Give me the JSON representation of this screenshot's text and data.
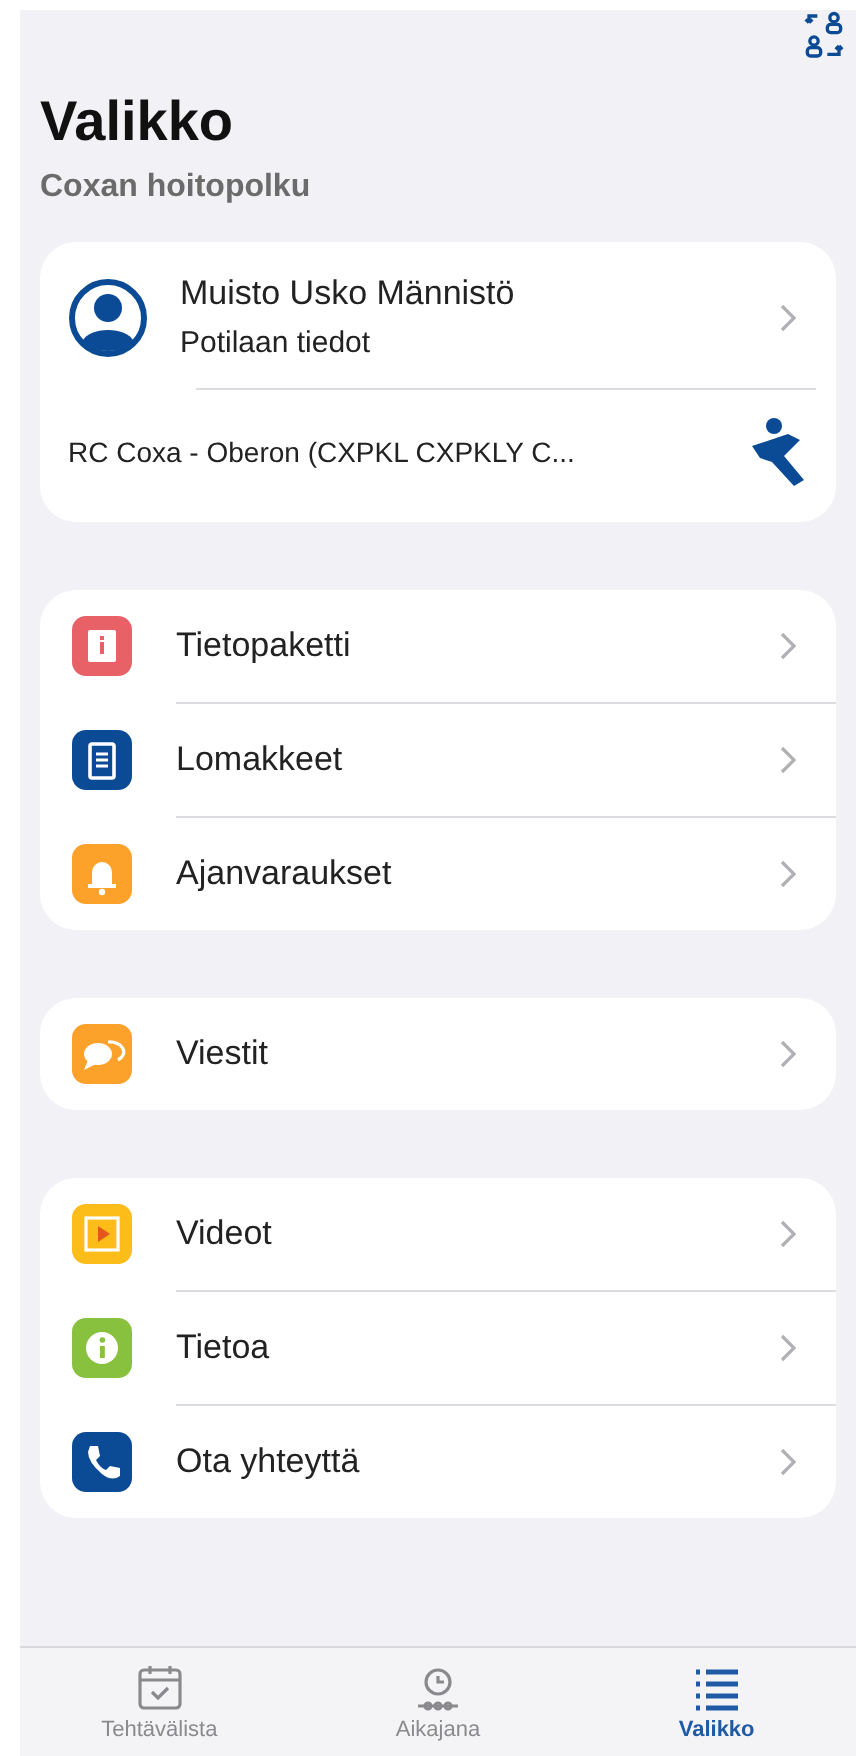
{
  "header": {
    "title": "Valikko",
    "subtitle": "Coxan hoitopolku"
  },
  "profile": {
    "name": "Muisto Usko Männistö",
    "caption": "Potilaan tiedot",
    "organization": "RC Coxa - Oberon (CXPKL CXPKLY C..."
  },
  "menu_groups": [
    {
      "items": [
        {
          "label": "Tietopaketti",
          "color": "#e86166"
        },
        {
          "label": "Lomakkeet",
          "color": "#0b4a94"
        },
        {
          "label": "Ajanvaraukset",
          "color": "#fca12a"
        }
      ]
    },
    {
      "items": [
        {
          "label": "Viestit",
          "color": "#fca12a"
        }
      ]
    },
    {
      "items": [
        {
          "label": "Videot",
          "color": "#fcbd1a"
        },
        {
          "label": "Tietoa",
          "color": "#88c13d"
        },
        {
          "label": "Ota yhteyttä",
          "color": "#0b4a94"
        }
      ]
    }
  ],
  "tabs": [
    {
      "label": "Tehtävälista",
      "selected": false
    },
    {
      "label": "Aikajana",
      "selected": false
    },
    {
      "label": "Valikko",
      "selected": true
    }
  ]
}
